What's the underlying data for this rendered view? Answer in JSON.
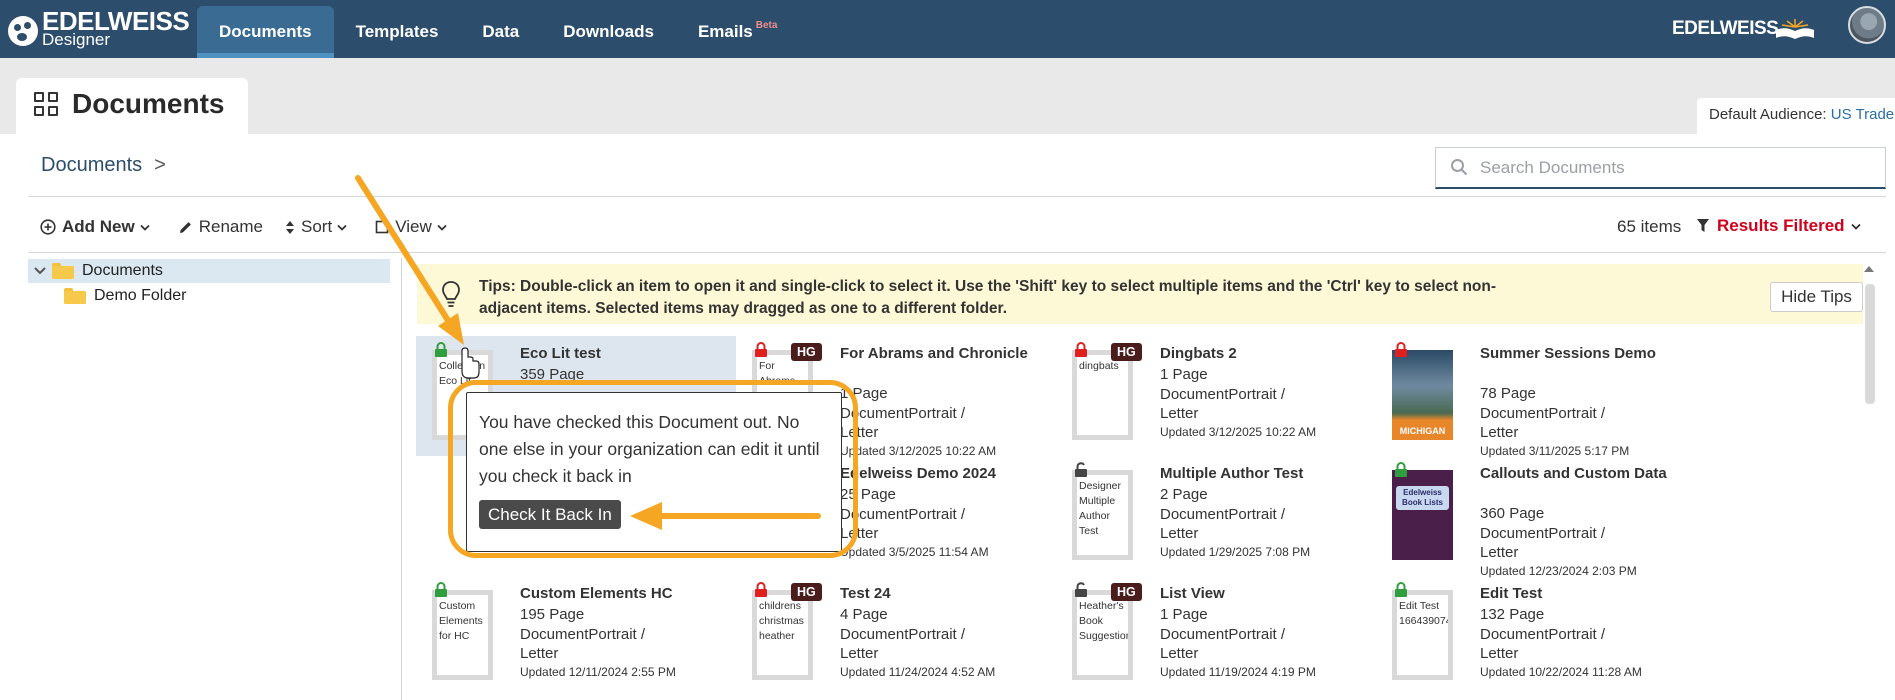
{
  "app": {
    "brand": "EDELWEISS",
    "sub": "Designer",
    "brand_right": "EDELWEISS"
  },
  "nav": {
    "tabs": [
      {
        "label": "Documents",
        "active": true
      },
      {
        "label": "Templates"
      },
      {
        "label": "Data"
      },
      {
        "label": "Downloads"
      },
      {
        "label": "Emails"
      }
    ],
    "beta": "Beta"
  },
  "page": {
    "title": "Documents",
    "audience_label": "Default Audience:",
    "audience_value": "US Trade"
  },
  "breadcrumb": {
    "root": "Documents",
    "sep": ">"
  },
  "search": {
    "placeholder": "Search Documents"
  },
  "toolbar": {
    "add_new": "Add New",
    "rename": "Rename",
    "sort": "Sort",
    "view": "View",
    "count": "65 items",
    "filtered": "Results Filtered"
  },
  "tree": {
    "root": "Documents",
    "child": "Demo Folder"
  },
  "tips": {
    "text": "Tips: Double-click an item to open it and single-click to select it. Use the 'Shift' key to select multiple items and the 'Ctrl' key to select non-adjacent items. Selected items may dragged as one to a different folder.",
    "hide": "Hide Tips"
  },
  "popover": {
    "message": "You have checked this Document out. No one else in your organization can edit it until you check it back in",
    "button": "Check It Back In"
  },
  "documents": [
    {
      "name": "Eco Lit test",
      "pages": "359 Page",
      "thumb": "Collection Eco Lit",
      "lock": "green"
    },
    {
      "name": "For Abrams and Chronicle",
      "pages": "1 Page",
      "type": "DocumentPortrait /",
      "size": "Letter",
      "updated": "Updated 3/12/2025 10:22 AM",
      "thumb": "For Abrams",
      "lock": "red",
      "badge": "HG"
    },
    {
      "name": "Dingbats 2",
      "pages": "1 Page",
      "type": "DocumentPortrait /",
      "size": "Letter",
      "updated": "Updated 3/12/2025 10:22 AM",
      "thumb": "dingbats",
      "lock": "red",
      "badge": "HG"
    },
    {
      "name": "Summer Sessions Demo",
      "pages": "78 Page",
      "type": "DocumentPortrait /",
      "size": "Letter",
      "updated": "Updated 3/11/2025 5:17 PM",
      "cover": "MICHIGAN",
      "lock": "red"
    },
    {
      "name": "Edelweiss Demo 2024",
      "pages": "25 Page",
      "type": "DocumentPortrait /",
      "size": "Letter",
      "updated": "Updated 3/5/2025 11:54 AM"
    },
    {
      "name": "Multiple Author Test",
      "pages": "2 Page",
      "type": "DocumentPortrait /",
      "size": "Letter",
      "updated": "Updated 1/29/2025 7:08 PM",
      "thumb": "Designer Multiple Author Test",
      "lock": "gray"
    },
    {
      "name": "Callouts and Custom Data",
      "pages": "360 Page",
      "type": "DocumentPortrait /",
      "size": "Letter",
      "updated": "Updated 12/23/2024 2:03 PM",
      "cover": "Edelweiss Book Lists",
      "lock": "green"
    },
    {
      "name": "Custom Elements HC",
      "pages": "195 Page",
      "type": "DocumentPortrait /",
      "size": "Letter",
      "updated": "Updated 12/11/2024 2:55 PM",
      "thumb": "Custom Elements for HC",
      "lock": "green"
    },
    {
      "name": "Test 24",
      "pages": "4 Page",
      "type": "DocumentPortrait /",
      "size": "Letter",
      "updated": "Updated 11/24/2024 4:52 AM",
      "thumb": "childrens christmas heather",
      "lock": "red",
      "badge": "HG"
    },
    {
      "name": "List View",
      "pages": "1 Page",
      "type": "DocumentPortrait /",
      "size": "Letter",
      "updated": "Updated 11/19/2024 4:19 PM",
      "thumb": "Heather's Book Suggestion",
      "lock": "gray",
      "badge": "HG"
    },
    {
      "name": "Edit Test",
      "pages": "132 Page",
      "type": "DocumentPortrait /",
      "size": "Letter",
      "updated": "Updated 10/22/2024 11:28 AM",
      "thumb": "Edit Test 166439074",
      "lock": "green"
    }
  ],
  "colors": {
    "nav_bg": "#2c4e6c",
    "nav_active": "#3a6c93",
    "filtered_red": "#d0021b",
    "annotation_orange": "#f5a623",
    "tips_bg": "#fdf8d5"
  }
}
